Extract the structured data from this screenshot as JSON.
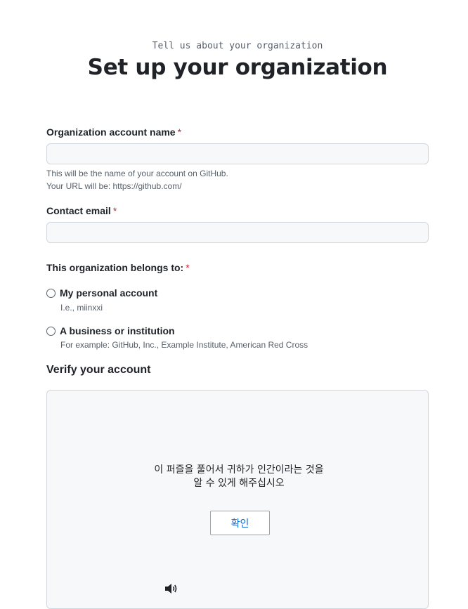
{
  "header": {
    "eyebrow": "Tell us about your organization",
    "title": "Set up your organization"
  },
  "org_name": {
    "label": "Organization account name",
    "required_mark": "*",
    "value": "",
    "note_line1": "This will be the name of your account on GitHub.",
    "note_line2": "Your URL will be: https://github.com/"
  },
  "contact_email": {
    "label": "Contact email",
    "required_mark": "*",
    "value": ""
  },
  "belongs_to": {
    "label": "This organization belongs to:",
    "required_mark": "*",
    "options": [
      {
        "label": "My personal account",
        "note": "I.e., miinxxi",
        "selected": false
      },
      {
        "label": "A business or institution",
        "note": "For example: GitHub, Inc., Example Institute, American Red Cross",
        "selected": false
      }
    ]
  },
  "verify": {
    "title": "Verify your account",
    "prompt_line1": "이 퍼즐을 풀어서 귀하가 인간이라는 것을",
    "prompt_line2": "알 수 있게 해주십시오",
    "confirm_label": "확인",
    "audio_icon": "speaker-icon"
  },
  "colors": {
    "required": "#cf222e",
    "link": "#0969da",
    "input_bg": "#f6f8fa",
    "border": "#d0d7de"
  }
}
